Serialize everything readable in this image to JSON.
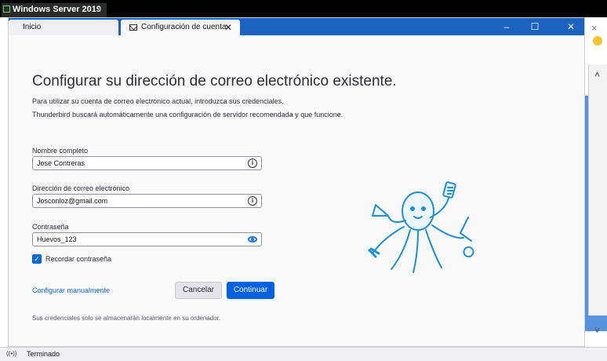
{
  "vm": {
    "title": "Windows Server 2019",
    "close": "×"
  },
  "tabs": [
    {
      "label": "Inicio"
    },
    {
      "label": "Configuración de cuenta",
      "close": "✕"
    }
  ],
  "window_controls": {
    "minimize": "–",
    "maximize": "☐",
    "close": "✕"
  },
  "page": {
    "title": "Configurar su dirección de correo electrónico existente.",
    "desc1": "Para utilizar su cuenta de correo electrónico actual, introduzca sus credenciales.",
    "desc2": "Thunderbird buscará automáticamente una configuración de servidor recomendada y que funcione."
  },
  "form": {
    "name_label": "Nombre completo",
    "name_value": "Jose Contreras",
    "email_label": "Dirección de correo electrónico",
    "email_value": "Josconloz@gmail.com",
    "password_label": "Contraseña",
    "password_value": "Huevos_123",
    "remember_label": "Recordar contraseña",
    "remember_checked": true,
    "info_icon": "i",
    "check_mark": "✓"
  },
  "actions": {
    "manual": "Configurar manualmente",
    "cancel": "Cancelar",
    "continue": "Continuar"
  },
  "footer_note": "Sus credenciales solo se almacenarán localmente en su ordenador.",
  "statusbar": {
    "signal": "((•))",
    "text": "Terminado"
  },
  "colors": {
    "accent": "#0061e0",
    "titlebar": "#1c62c0",
    "mascot": "#1f8fd6"
  },
  "icons": [
    "envelope-icon",
    "info-icon",
    "eye-icon",
    "checkbox-icon",
    "octopus-mascot"
  ]
}
